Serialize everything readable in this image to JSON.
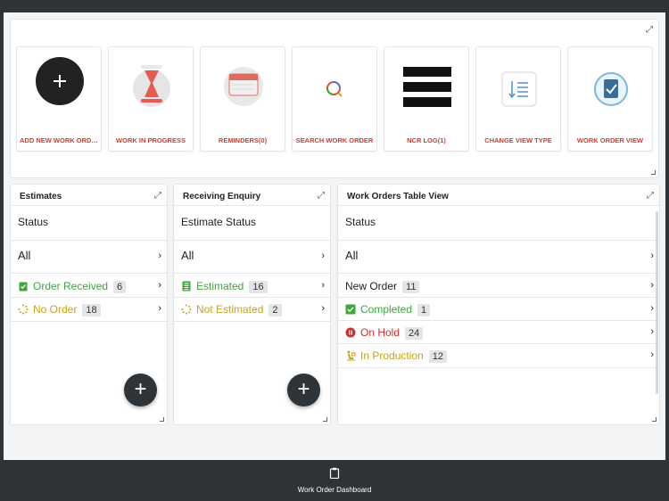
{
  "tiles": [
    {
      "label": "ADD NEW WORK ORDER",
      "icon": "plus-icon"
    },
    {
      "label": "WORK IN PROGRESS",
      "icon": "hourglass-icon"
    },
    {
      "label": "REMINDERS(0)",
      "icon": "calendar-icon"
    },
    {
      "label": "SEARCH WORK ORDER",
      "icon": "search-icon"
    },
    {
      "label": "NCR LOG(1)",
      "icon": "menu-lines-icon"
    },
    {
      "label": "CHANGE VIEW TYPE",
      "icon": "sort-list-icon"
    },
    {
      "label": "WORK ORDER VIEW",
      "icon": "clipboard-check-icon"
    }
  ],
  "estimates": {
    "title": "Estimates",
    "status_label": "Status",
    "all_label": "All",
    "items": [
      {
        "label": "Order Received",
        "count": "6",
        "color": "#3aa83a",
        "icon": "clipboard-check-icon"
      },
      {
        "label": "No Order",
        "count": "18",
        "color": "#c8a21a",
        "icon": "spinner-icon"
      }
    ]
  },
  "receiving": {
    "title": "Receiving Enquiry",
    "status_label": "Estimate Status",
    "all_label": "All",
    "items": [
      {
        "label": "Estimated",
        "count": "16",
        "color": "#3aa83a",
        "icon": "list-document-icon"
      },
      {
        "label": "Not Estimated",
        "count": "2",
        "color": "#c8a21a",
        "icon": "spinner-icon"
      }
    ]
  },
  "work_orders": {
    "title": "Work Orders Table View",
    "status_label": "Status",
    "all_label": "All",
    "items": [
      {
        "label": "New Order",
        "count": "11",
        "color": "#222222",
        "icon": ""
      },
      {
        "label": "Completed",
        "count": "1",
        "color": "#3aa83a",
        "icon": "checkbox-icon"
      },
      {
        "label": "On Hold",
        "count": "24",
        "color": "#c9302c",
        "icon": "pause-circle-icon"
      },
      {
        "label": "In Production",
        "count": "12",
        "color": "#c8a21a",
        "icon": "worker-icon"
      }
    ]
  },
  "bottom_nav": {
    "label": "Work Order Dashboard",
    "icon": "clipboard-icon"
  },
  "fab_symbol": "+",
  "chevron": "›",
  "expand_symbol": "⤢"
}
